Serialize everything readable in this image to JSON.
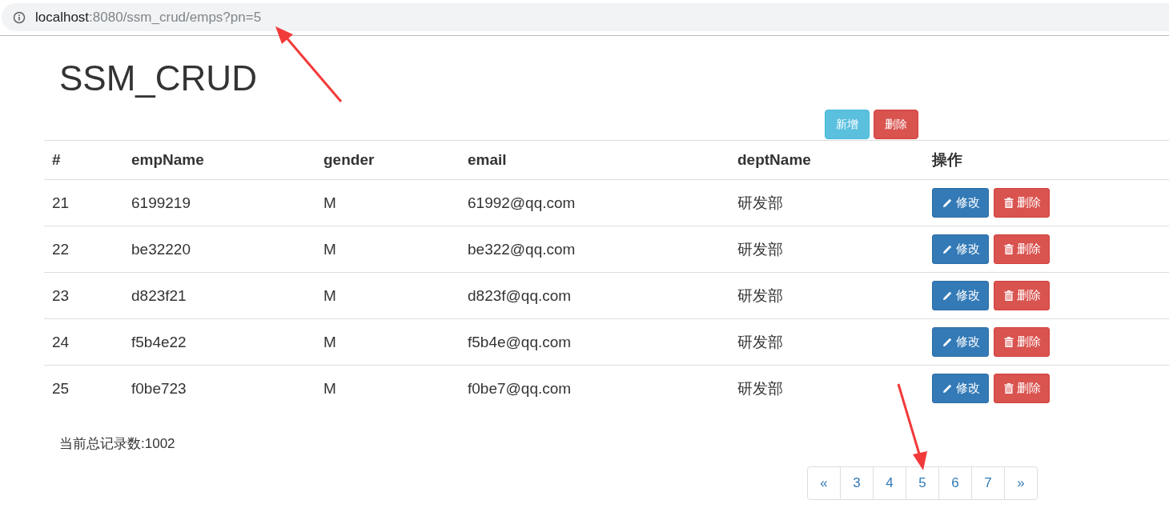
{
  "address_bar": {
    "host": "localhost",
    "path": ":8080/ssm_crud/emps?pn=5"
  },
  "title": "SSM_CRUD",
  "toolbar": [
    {
      "label": "新增",
      "kind": "info"
    },
    {
      "label": "删除",
      "kind": "danger"
    }
  ],
  "table": {
    "columns": [
      "#",
      "empName",
      "gender",
      "email",
      "deptName",
      "操作"
    ],
    "rows": [
      {
        "cells": [
          "21",
          "6199219",
          "M",
          "61992@qq.com",
          "研发部"
        ],
        "actions": [
          "修改",
          "删除"
        ]
      },
      {
        "cells": [
          "22",
          "be32220",
          "M",
          "be322@qq.com",
          "研发部"
        ],
        "actions": [
          "修改",
          "删除"
        ]
      },
      {
        "cells": [
          "23",
          "d823f21",
          "M",
          "d823f@qq.com",
          "研发部"
        ],
        "actions": [
          "修改",
          "删除"
        ]
      },
      {
        "cells": [
          "24",
          "f5b4e22",
          "M",
          "f5b4e@qq.com",
          "研发部"
        ],
        "actions": [
          "修改",
          "删除"
        ]
      },
      {
        "cells": [
          "25",
          "f0be723",
          "M",
          "f0be7@qq.com",
          "研发部"
        ],
        "actions": [
          "修改",
          "删除"
        ]
      }
    ]
  },
  "record_count": "当前总记录数:1002",
  "pagination": [
    {
      "label": "«",
      "selected": false
    },
    {
      "label": "3",
      "selected": false
    },
    {
      "label": "4",
      "selected": false
    },
    {
      "label": "5",
      "selected": false
    },
    {
      "label": "6",
      "selected": false
    },
    {
      "label": "7",
      "selected": false
    },
    {
      "label": "»",
      "selected": false
    }
  ]
}
